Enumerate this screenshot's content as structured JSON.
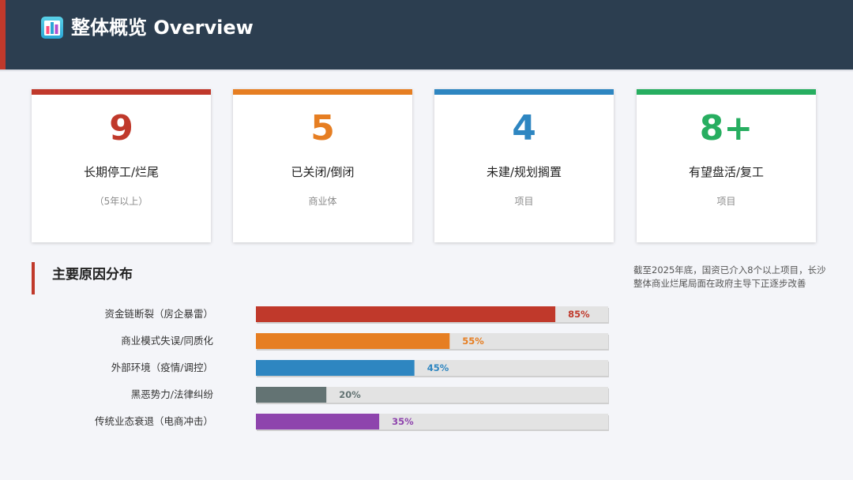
{
  "header": {
    "title": "整体概览 Overview",
    "icon": "bar-chart-icon",
    "bg_color": "#2c3e50",
    "accent_color": "#c0392b"
  },
  "cards": [
    {
      "value": "9",
      "label": "长期停工/烂尾",
      "sub": "（5年以上）",
      "color": "#c0392b"
    },
    {
      "value": "5",
      "label": "已关闭/倒闭",
      "sub": "商业体",
      "color": "#e67e22"
    },
    {
      "value": "4",
      "label": "未建/规划搁置",
      "sub": "项目",
      "color": "#2e86c1"
    },
    {
      "value": "8+",
      "label": "有望盘活/复工",
      "sub": "项目",
      "color": "#27ae60"
    }
  ],
  "section": {
    "title": "主要原因分布"
  },
  "note": "截至2025年底，国资已介入8个以上项目，长沙整体商业烂尾局面在政府主导下正逐步改善",
  "chart_data": {
    "type": "bar",
    "orientation": "horizontal",
    "categories": [
      "资金链断裂（房企暴雷）",
      "商业模式失误/同质化",
      "外部环境（疫情/调控）",
      "黑恶势力/法律纠纷",
      "传统业态衰退（电商冲击）"
    ],
    "values": [
      85,
      55,
      45,
      20,
      35
    ],
    "value_labels": [
      "85%",
      "55%",
      "45%",
      "20%",
      "35%"
    ],
    "colors": [
      "#c0392b",
      "#e67e22",
      "#2e86c1",
      "#637373",
      "#8e44ad"
    ],
    "xlim": [
      0,
      100
    ],
    "track_color": "#e3e3e3",
    "grid": false
  }
}
